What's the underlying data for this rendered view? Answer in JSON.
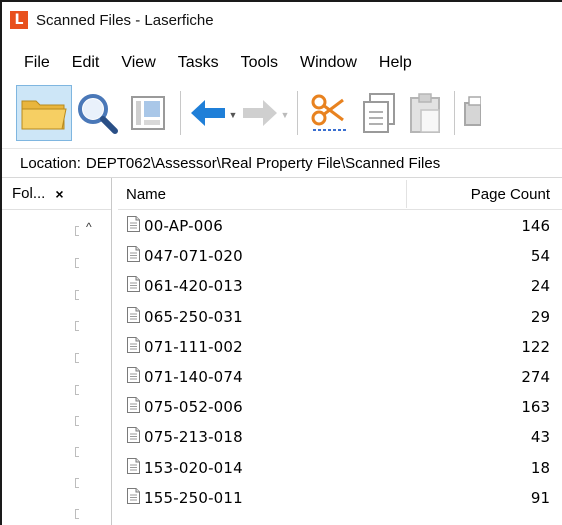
{
  "window": {
    "title": "Scanned Files - Laserfiche",
    "logo_letter": "L"
  },
  "menu": [
    {
      "label": "File"
    },
    {
      "label": "Edit"
    },
    {
      "label": "View"
    },
    {
      "label": "Tasks"
    },
    {
      "label": "Tools"
    },
    {
      "label": "Window"
    },
    {
      "label": "Help"
    }
  ],
  "toolbar": {
    "icons": [
      "folder-icon",
      "search-icon",
      "metadata-icon",
      "back-arrow-icon",
      "forward-arrow-icon",
      "cut-icon",
      "copy-icon",
      "paste-icon",
      "print-icon"
    ]
  },
  "location": {
    "label": "Location:",
    "path": "DEPT062\\Assessor\\Real Property File\\Scanned Files"
  },
  "folder_pane": {
    "title": "Fol...",
    "close": "×",
    "scroll_up": "^"
  },
  "columns": {
    "name": "Name",
    "page_count": "Page Count"
  },
  "rows": [
    {
      "name": "00-AP-006",
      "count": "146"
    },
    {
      "name": "047-071-020",
      "count": "54"
    },
    {
      "name": "061-420-013",
      "count": "24"
    },
    {
      "name": "065-250-031",
      "count": "29"
    },
    {
      "name": "071-111-002",
      "count": "122"
    },
    {
      "name": "071-140-074",
      "count": "274"
    },
    {
      "name": "075-052-006",
      "count": "163"
    },
    {
      "name": "075-213-018",
      "count": "43"
    },
    {
      "name": "153-020-014",
      "count": "18"
    },
    {
      "name": "155-250-011",
      "count": "91"
    }
  ],
  "colors": {
    "logo": "#e8501d",
    "back_arrow": "#1f7fd8",
    "folder": "#f3c14b",
    "disabled": "#c9c9c9",
    "cut_orange": "#e8821f",
    "cut_blue": "#3a6fd0"
  }
}
